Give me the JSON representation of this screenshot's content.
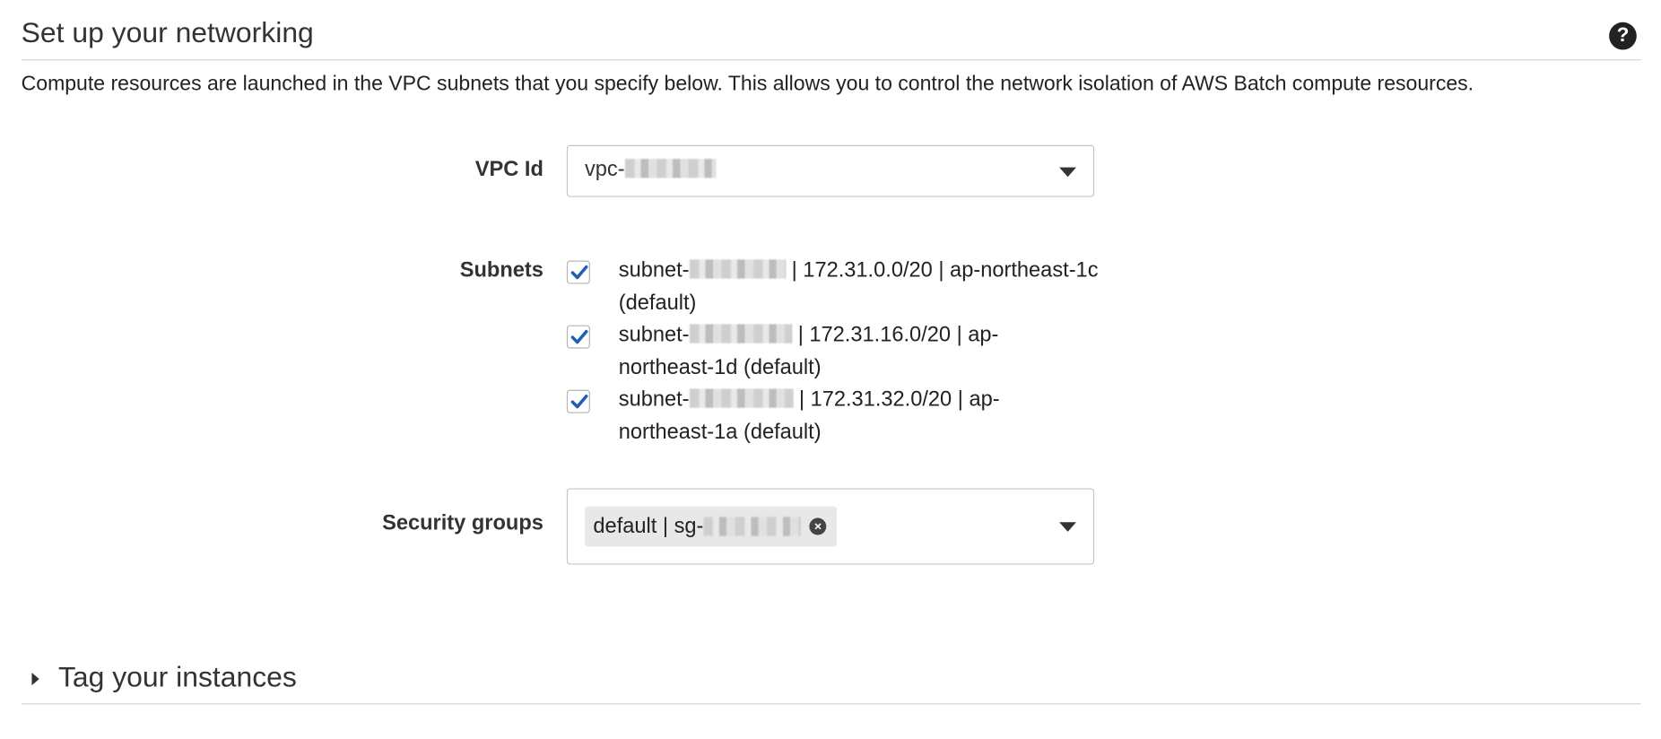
{
  "section": {
    "title": "Set up your networking",
    "help_icon": "question-circle-icon",
    "description": "Compute resources are launched in the VPC subnets that you specify below. This allows you to control the network isolation of AWS Batch compute resources."
  },
  "vpc": {
    "label": "VPC Id",
    "value_prefix": "vpc-"
  },
  "subnets": {
    "label": "Subnets",
    "items": [
      {
        "prefix": "subnet-",
        "suffix": " | 172.31.0.0/20 | ap-northeast-1c (default)",
        "checked": true
      },
      {
        "prefix": "subnet-",
        "suffix": " | 172.31.16.0/20 | ap-northeast-1d (default)",
        "checked": true
      },
      {
        "prefix": "subnet-",
        "suffix": " | 172.31.32.0/20 | ap-northeast-1a (default)",
        "checked": true
      }
    ]
  },
  "security_groups": {
    "label": "Security groups",
    "token_prefix": "default | sg-",
    "remove_icon": "close-circle-icon"
  },
  "tags": {
    "title": "Tag your instances",
    "expand_icon": "caret-right-icon"
  },
  "colors": {
    "checkmark": "#1f5fb4",
    "divider": "#d5d5d5",
    "token_bg": "#e8e8e8"
  }
}
